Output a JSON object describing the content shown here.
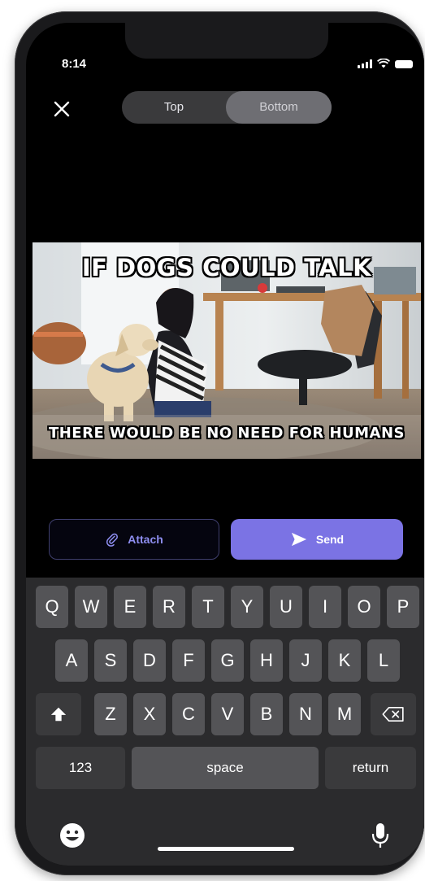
{
  "status": {
    "time": "8:14"
  },
  "segment": {
    "top_label": "Top",
    "bottom_label": "Bottom",
    "selected": "Bottom"
  },
  "meme": {
    "top_text": "IF DOGS COULD TALK",
    "bottom_text": "THERE WOULD BE NO NEED FOR HUMANS"
  },
  "actions": {
    "attach_label": "Attach",
    "send_label": "Send"
  },
  "keyboard": {
    "row1": [
      "Q",
      "W",
      "E",
      "R",
      "T",
      "Y",
      "U",
      "I",
      "O",
      "P"
    ],
    "row2": [
      "A",
      "S",
      "D",
      "F",
      "G",
      "H",
      "J",
      "K",
      "L"
    ],
    "row3": [
      "Z",
      "X",
      "C",
      "V",
      "B",
      "N",
      "M"
    ],
    "numbers_label": "123",
    "space_label": "space",
    "return_label": "return"
  },
  "icons": {
    "close": "close-icon",
    "attach": "paperclip-icon",
    "send": "send-arrow-icon",
    "shift": "shift-icon",
    "backspace": "backspace-icon",
    "emoji": "emoji-icon",
    "mic": "microphone-icon"
  },
  "colors": {
    "accent": "#7b73e4",
    "attach_text": "#8e8ef0"
  }
}
